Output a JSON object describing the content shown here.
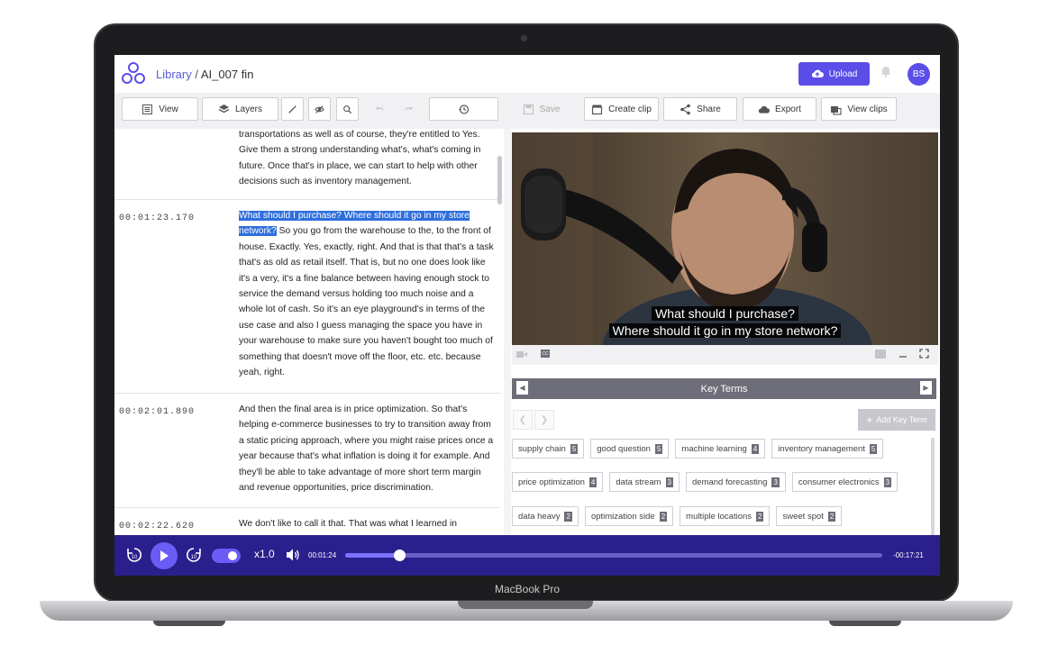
{
  "device": {
    "label": "MacBook Pro"
  },
  "header": {
    "breadcrumb_root": "Library",
    "breadcrumb_sep": " / ",
    "breadcrumb_current": "AI_007 fin",
    "upload_label": "Upload",
    "avatar_initials": "BS"
  },
  "toolbar": {
    "view_label": "View",
    "layers_label": "Layers",
    "save_label": "Save",
    "create_clip_label": "Create clip",
    "share_label": "Share",
    "export_label": "Export",
    "view_clips_label": "View clips"
  },
  "transcript": {
    "segments": [
      {
        "time": "",
        "text": "transportations as well as of course, they're entitled to Yes. Give them a strong understanding what's, what's coming in future. Once that's in place, we can start to help with other decisions such as inventory management."
      },
      {
        "time": "00:01:23.170",
        "highlight": "What should I purchase? Where should it go in my store network?",
        "text": " So you go from the warehouse to the, to the front of house. Exactly. Yes, exactly, right. And that is that that's a task that's as old as retail itself. That is, but no one does look like it's a very, it's a fine balance between having enough stock to service the demand versus holding too much noise and a whole lot of cash. So it's an eye playground's in terms of the use case and also I guess managing the space you have in your warehouse to make sure you haven't bought too much of something that doesn't move off the floor, etc. etc. because yeah, right."
      },
      {
        "time": "00:02:01.890",
        "text": "And then the final area is in price optimization. So that's helping e-commerce businesses to try to transition away from a static pricing approach, where you might raise prices once a year because that's what inflation is doing it for example. And they'll be able to take advantage of more short term margin and revenue opportunities, price discrimination."
      },
      {
        "time": "00:02:22.620",
        "text": "We don't like to call it that. That was what I learned in"
      }
    ]
  },
  "video": {
    "subtitle_line1": "What should I purchase?",
    "subtitle_line2": "Where should it go in my store network?",
    "cc_label": "CC"
  },
  "key_terms": {
    "title": "Key Terms",
    "add_label": "Add Key Term",
    "terms": [
      {
        "label": "supply chain",
        "count": "5"
      },
      {
        "label": "good question",
        "count": "5"
      },
      {
        "label": "machine learning",
        "count": "4"
      },
      {
        "label": "inventory management",
        "count": "5"
      },
      {
        "label": "price optimization",
        "count": "4"
      },
      {
        "label": "data stream",
        "count": "3"
      },
      {
        "label": "demand forecasting",
        "count": "3"
      },
      {
        "label": "consumer electronics",
        "count": "3"
      },
      {
        "label": "data heavy",
        "count": "2"
      },
      {
        "label": "optimization side",
        "count": "2"
      },
      {
        "label": "multiple locations",
        "count": "2"
      },
      {
        "label": "sweet spot",
        "count": "2"
      }
    ]
  },
  "player": {
    "speed": "x1.0",
    "current_time": "00:01:24",
    "remaining_time": "-00:17:21",
    "progress_fraction": 0.1,
    "skip_back_label": "10",
    "skip_forward_label": "10"
  },
  "colors": {
    "accent": "#5b4de8",
    "player_bg": "#2a1f8c",
    "highlight": "#2f6fdc"
  }
}
